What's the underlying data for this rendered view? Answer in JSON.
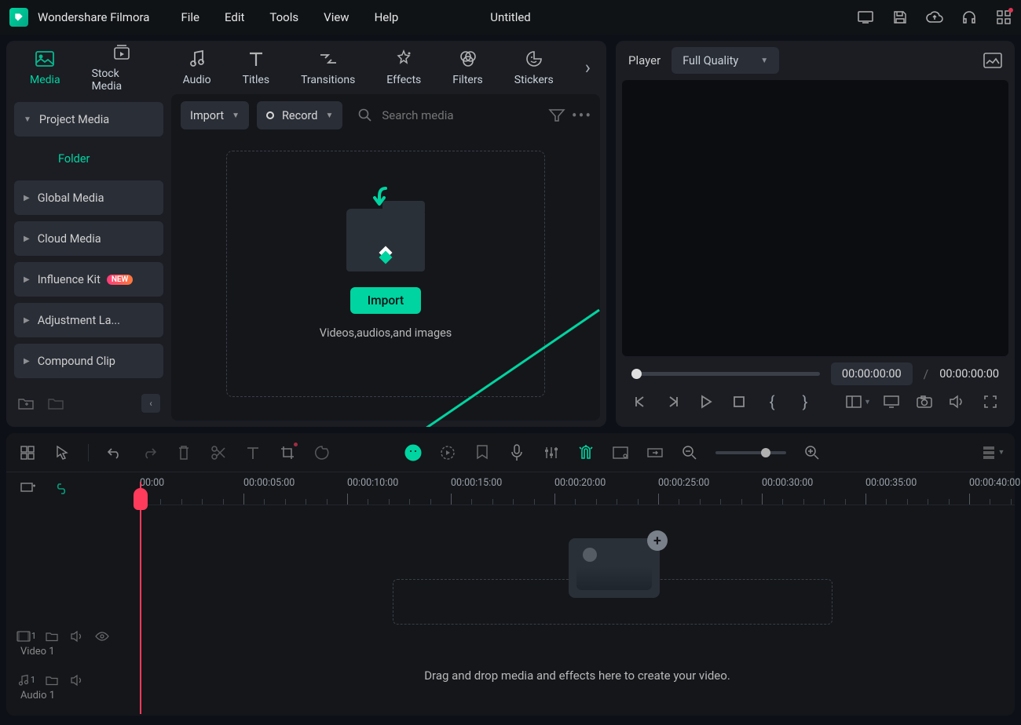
{
  "app": {
    "name": "Wondershare Filmora",
    "doc_title": "Untitled"
  },
  "menus": [
    "File",
    "Edit",
    "Tools",
    "View",
    "Help"
  ],
  "tabs": [
    {
      "label": "Media",
      "active": true
    },
    {
      "label": "Stock Media"
    },
    {
      "label": "Audio"
    },
    {
      "label": "Titles"
    },
    {
      "label": "Transitions"
    },
    {
      "label": "Effects"
    },
    {
      "label": "Filters"
    },
    {
      "label": "Stickers"
    }
  ],
  "sidebar": {
    "project_media": "Project Media",
    "folder": "Folder",
    "items": [
      {
        "label": "Global Media"
      },
      {
        "label": "Cloud Media"
      },
      {
        "label": "Influence Kit",
        "badge": "NEW"
      },
      {
        "label": "Adjustment La..."
      },
      {
        "label": "Compound Clip"
      }
    ]
  },
  "media_toolbar": {
    "import": "Import",
    "record": "Record",
    "search_placeholder": "Search media"
  },
  "dropzone": {
    "button": "Import",
    "text": "Videos,audios,and images"
  },
  "player": {
    "label": "Player",
    "quality": "Full Quality",
    "time_current": "00:00:00:00",
    "time_total": "00:00:00:00"
  },
  "timeline": {
    "ruler": [
      "00:00",
      "00:00:05:00",
      "00:00:10:00",
      "00:00:15:00",
      "00:00:20:00",
      "00:00:25:00",
      "00:00:30:00",
      "00:00:35:00",
      "00:00:40:00"
    ],
    "tracks": [
      {
        "num": "1",
        "label": "Video 1",
        "type": "video"
      },
      {
        "num": "1",
        "label": "Audio 1",
        "type": "audio"
      }
    ],
    "drop_hint": "Drag and drop media and effects here to create your video."
  }
}
